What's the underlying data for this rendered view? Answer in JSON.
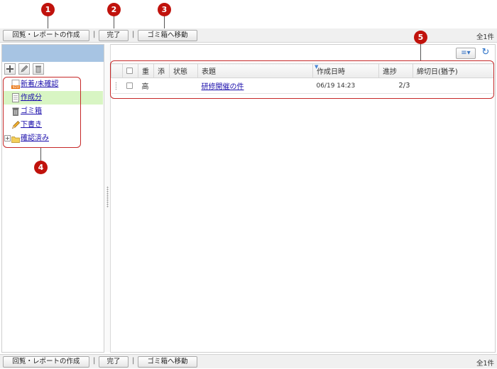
{
  "toolbar": {
    "create_label": "回覧・レポートの作成",
    "sep": "|",
    "complete_label": "完了",
    "trash_label": "ゴミ箱へ移動",
    "count": "全1件"
  },
  "tree": {
    "items": [
      {
        "label": "新着/未確認",
        "icon": "new-mail-icon"
      },
      {
        "label": "作成分",
        "icon": "document-icon",
        "selected": true
      },
      {
        "label": "ゴミ箱",
        "icon": "trash-icon"
      },
      {
        "label": "下書き",
        "icon": "pencil-icon"
      },
      {
        "label": "確認済み",
        "icon": "folder-icon",
        "expander": "+"
      }
    ]
  },
  "list": {
    "columns": [
      "重",
      "添",
      "状態",
      "表題",
      "作成日時",
      "進捗",
      "締切日(猶予)"
    ],
    "rows": [
      {
        "priority": "高",
        "attachment": "",
        "status": "",
        "subject": "研修開催の件",
        "created": "06/19 14:23",
        "progress": "2/3",
        "deadline": ""
      }
    ]
  },
  "callouts": [
    "1",
    "2",
    "3",
    "4",
    "5"
  ],
  "colors": {
    "accent": "#c0120c",
    "selected_row": "#d8f5c3",
    "pane_header": "#a7c4e3",
    "link": "#1a0dab"
  }
}
